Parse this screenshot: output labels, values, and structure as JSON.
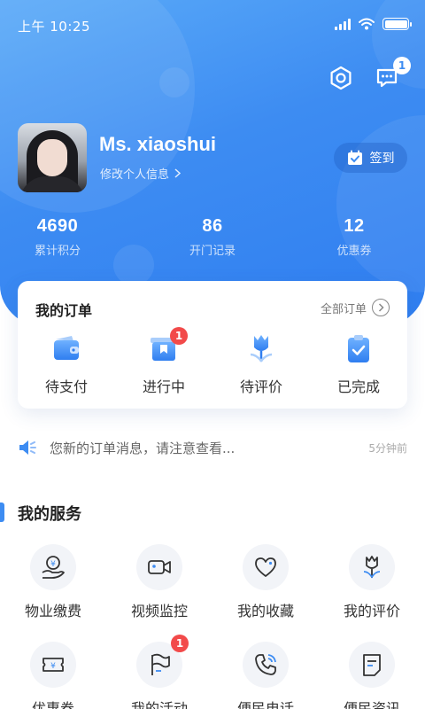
{
  "status_bar": {
    "time": "上午 10:25"
  },
  "header": {
    "message_badge": "1"
  },
  "profile": {
    "name": "Ms. xiaoshui",
    "edit_label": "修改个人信息",
    "signin_label": "签到"
  },
  "stats": [
    {
      "value": "4690",
      "label": "累计积分"
    },
    {
      "value": "86",
      "label": "开门记录"
    },
    {
      "value": "12",
      "label": "优惠券"
    }
  ],
  "orders": {
    "title": "我的订单",
    "all_label": "全部订单",
    "items": [
      {
        "label": "待支付",
        "icon": "wallet-icon",
        "badge": ""
      },
      {
        "label": "进行中",
        "icon": "box-icon",
        "badge": "1"
      },
      {
        "label": "待评价",
        "icon": "tulip-icon",
        "badge": ""
      },
      {
        "label": "已完成",
        "icon": "clipboard-check-icon",
        "badge": ""
      }
    ]
  },
  "notice": {
    "text": "您新的订单消息，请注意查看...",
    "time": "5分钟前"
  },
  "services": {
    "title": "我的服务",
    "items": [
      {
        "label": "物业缴费",
        "icon": "yuan-hand-icon",
        "badge": ""
      },
      {
        "label": "视频监控",
        "icon": "video-camera-icon",
        "badge": ""
      },
      {
        "label": "我的收藏",
        "icon": "heart-icon",
        "badge": ""
      },
      {
        "label": "我的评价",
        "icon": "tulip-icon",
        "badge": ""
      },
      {
        "label": "优惠券",
        "icon": "coupon-icon",
        "badge": ""
      },
      {
        "label": "我的活动",
        "icon": "flag-icon",
        "badge": "1"
      },
      {
        "label": "便民电话",
        "icon": "phone-icon",
        "badge": ""
      },
      {
        "label": "便民资讯",
        "icon": "document-icon",
        "badge": ""
      }
    ]
  },
  "colors": {
    "primary": "#3d8cf2",
    "badge_red": "#f24a4a"
  }
}
